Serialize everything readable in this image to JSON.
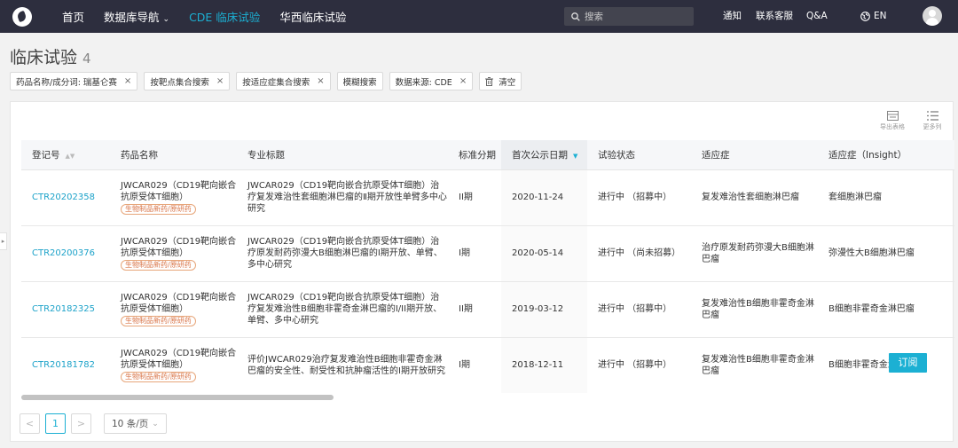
{
  "nav": {
    "items": [
      {
        "label": "首页"
      },
      {
        "label": "数据库导航"
      },
      {
        "label": "CDE 临床试验"
      },
      {
        "label": "华西临床试验"
      }
    ],
    "search_placeholder": "搜索",
    "links": {
      "notify": "通知",
      "service": "联系客服",
      "qa": "Q&A",
      "lang": "EN"
    }
  },
  "page": {
    "title": "临床试验",
    "count": "4"
  },
  "filters": [
    {
      "label": "药品名称/成分词: 瑞基仑赛"
    },
    {
      "label": "按靶点集合搜索"
    },
    {
      "label": "按适应症集合搜索"
    },
    {
      "label": "模糊搜索"
    },
    {
      "label": "数据来源: CDE"
    },
    {
      "label": "清空"
    }
  ],
  "tools": {
    "export": "导出表格",
    "more": "更多列"
  },
  "table": {
    "headers": [
      "登记号",
      "药品名称",
      "专业标题",
      "标准分期",
      "首次公示日期",
      "试验状态",
      "适应症",
      "适应症（Insight）"
    ],
    "rows": [
      {
        "id": "CTR20202358",
        "drug": "JWCAR029（CD19靶向嵌合抗原受体T细胞）",
        "tag": "生物制品新药/原研药",
        "title": "JWCAR029（CD19靶向嵌合抗原受体T细胞）治疗复发难治性套细胞淋巴瘤的Ⅱ期开放性单臂多中心研究",
        "phase": "II期",
        "date": "2020-11-24",
        "status": "进行中 （招募中）",
        "indication": "复发难治性套细胞淋巴瘤",
        "insight": "套细胞淋巴瘤"
      },
      {
        "id": "CTR20200376",
        "drug": "JWCAR029（CD19靶向嵌合抗原受体T细胞）",
        "tag": "生物制品新药/原研药",
        "title": "JWCAR029（CD19靶向嵌合抗原受体T细胞）治疗原发耐药弥漫大B细胞淋巴瘤的I期开放、单臂、多中心研究",
        "phase": "I期",
        "date": "2020-05-14",
        "status": "进行中 （尚未招募）",
        "indication": "治疗原发耐药弥漫大B细胞淋巴瘤",
        "insight": "弥漫性大B细胞淋巴瘤"
      },
      {
        "id": "CTR20182325",
        "drug": "JWCAR029（CD19靶向嵌合抗原受体T细胞）",
        "tag": "生物制品新药/原研药",
        "title": "JWCAR029（CD19靶向嵌合抗原受体T细胞）治疗复发难治性B细胞非霍奇金淋巴瘤的I/II期开放、单臂、多中心研究",
        "phase": "II期",
        "date": "2019-03-12",
        "status": "进行中 （招募中）",
        "indication": "复发难治性B细胞非霍奇金淋巴瘤",
        "insight": "B细胞非霍奇金淋巴瘤"
      },
      {
        "id": "CTR20181782",
        "drug": "JWCAR029（CD19靶向嵌合抗原受体T细胞）",
        "tag": "生物制品新药/原研药",
        "title": "评价JWCAR029治疗复发难治性B细胞非霍奇金淋巴瘤的安全性、耐受性和抗肿瘤活性的I期开放研究",
        "phase": "I期",
        "date": "2018-12-11",
        "status": "进行中 （招募中）",
        "indication": "复发难治性B细胞非霍奇金淋巴瘤",
        "insight": "B细胞非霍奇金淋巴瘤"
      }
    ]
  },
  "subscribe_label": "订阅",
  "pager": {
    "prev": "<",
    "current": "1",
    "next": ">",
    "page_size": "10 条/页"
  }
}
